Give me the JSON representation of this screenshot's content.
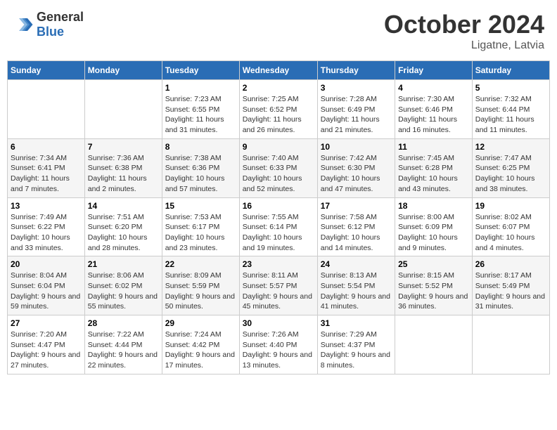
{
  "header": {
    "logo_general": "General",
    "logo_blue": "Blue",
    "month_title": "October 2024",
    "subtitle": "Ligatne, Latvia"
  },
  "days_of_week": [
    "Sunday",
    "Monday",
    "Tuesday",
    "Wednesday",
    "Thursday",
    "Friday",
    "Saturday"
  ],
  "weeks": [
    [
      {
        "day": "",
        "info": ""
      },
      {
        "day": "",
        "info": ""
      },
      {
        "day": "1",
        "sunrise": "7:23 AM",
        "sunset": "6:55 PM",
        "daylight": "11 hours and 31 minutes."
      },
      {
        "day": "2",
        "sunrise": "7:25 AM",
        "sunset": "6:52 PM",
        "daylight": "11 hours and 26 minutes."
      },
      {
        "day": "3",
        "sunrise": "7:28 AM",
        "sunset": "6:49 PM",
        "daylight": "11 hours and 21 minutes."
      },
      {
        "day": "4",
        "sunrise": "7:30 AM",
        "sunset": "6:46 PM",
        "daylight": "11 hours and 16 minutes."
      },
      {
        "day": "5",
        "sunrise": "7:32 AM",
        "sunset": "6:44 PM",
        "daylight": "11 hours and 11 minutes."
      }
    ],
    [
      {
        "day": "6",
        "sunrise": "7:34 AM",
        "sunset": "6:41 PM",
        "daylight": "11 hours and 7 minutes."
      },
      {
        "day": "7",
        "sunrise": "7:36 AM",
        "sunset": "6:38 PM",
        "daylight": "11 hours and 2 minutes."
      },
      {
        "day": "8",
        "sunrise": "7:38 AM",
        "sunset": "6:36 PM",
        "daylight": "10 hours and 57 minutes."
      },
      {
        "day": "9",
        "sunrise": "7:40 AM",
        "sunset": "6:33 PM",
        "daylight": "10 hours and 52 minutes."
      },
      {
        "day": "10",
        "sunrise": "7:42 AM",
        "sunset": "6:30 PM",
        "daylight": "10 hours and 47 minutes."
      },
      {
        "day": "11",
        "sunrise": "7:45 AM",
        "sunset": "6:28 PM",
        "daylight": "10 hours and 43 minutes."
      },
      {
        "day": "12",
        "sunrise": "7:47 AM",
        "sunset": "6:25 PM",
        "daylight": "10 hours and 38 minutes."
      }
    ],
    [
      {
        "day": "13",
        "sunrise": "7:49 AM",
        "sunset": "6:22 PM",
        "daylight": "10 hours and 33 minutes."
      },
      {
        "day": "14",
        "sunrise": "7:51 AM",
        "sunset": "6:20 PM",
        "daylight": "10 hours and 28 minutes."
      },
      {
        "day": "15",
        "sunrise": "7:53 AM",
        "sunset": "6:17 PM",
        "daylight": "10 hours and 23 minutes."
      },
      {
        "day": "16",
        "sunrise": "7:55 AM",
        "sunset": "6:14 PM",
        "daylight": "10 hours and 19 minutes."
      },
      {
        "day": "17",
        "sunrise": "7:58 AM",
        "sunset": "6:12 PM",
        "daylight": "10 hours and 14 minutes."
      },
      {
        "day": "18",
        "sunrise": "8:00 AM",
        "sunset": "6:09 PM",
        "daylight": "10 hours and 9 minutes."
      },
      {
        "day": "19",
        "sunrise": "8:02 AM",
        "sunset": "6:07 PM",
        "daylight": "10 hours and 4 minutes."
      }
    ],
    [
      {
        "day": "20",
        "sunrise": "8:04 AM",
        "sunset": "6:04 PM",
        "daylight": "9 hours and 59 minutes."
      },
      {
        "day": "21",
        "sunrise": "8:06 AM",
        "sunset": "6:02 PM",
        "daylight": "9 hours and 55 minutes."
      },
      {
        "day": "22",
        "sunrise": "8:09 AM",
        "sunset": "5:59 PM",
        "daylight": "9 hours and 50 minutes."
      },
      {
        "day": "23",
        "sunrise": "8:11 AM",
        "sunset": "5:57 PM",
        "daylight": "9 hours and 45 minutes."
      },
      {
        "day": "24",
        "sunrise": "8:13 AM",
        "sunset": "5:54 PM",
        "daylight": "9 hours and 41 minutes."
      },
      {
        "day": "25",
        "sunrise": "8:15 AM",
        "sunset": "5:52 PM",
        "daylight": "9 hours and 36 minutes."
      },
      {
        "day": "26",
        "sunrise": "8:17 AM",
        "sunset": "5:49 PM",
        "daylight": "9 hours and 31 minutes."
      }
    ],
    [
      {
        "day": "27",
        "sunrise": "7:20 AM",
        "sunset": "4:47 PM",
        "daylight": "9 hours and 27 minutes."
      },
      {
        "day": "28",
        "sunrise": "7:22 AM",
        "sunset": "4:44 PM",
        "daylight": "9 hours and 22 minutes."
      },
      {
        "day": "29",
        "sunrise": "7:24 AM",
        "sunset": "4:42 PM",
        "daylight": "9 hours and 17 minutes."
      },
      {
        "day": "30",
        "sunrise": "7:26 AM",
        "sunset": "4:40 PM",
        "daylight": "9 hours and 13 minutes."
      },
      {
        "day": "31",
        "sunrise": "7:29 AM",
        "sunset": "4:37 PM",
        "daylight": "9 hours and 8 minutes."
      },
      {
        "day": "",
        "info": ""
      },
      {
        "day": "",
        "info": ""
      }
    ]
  ]
}
